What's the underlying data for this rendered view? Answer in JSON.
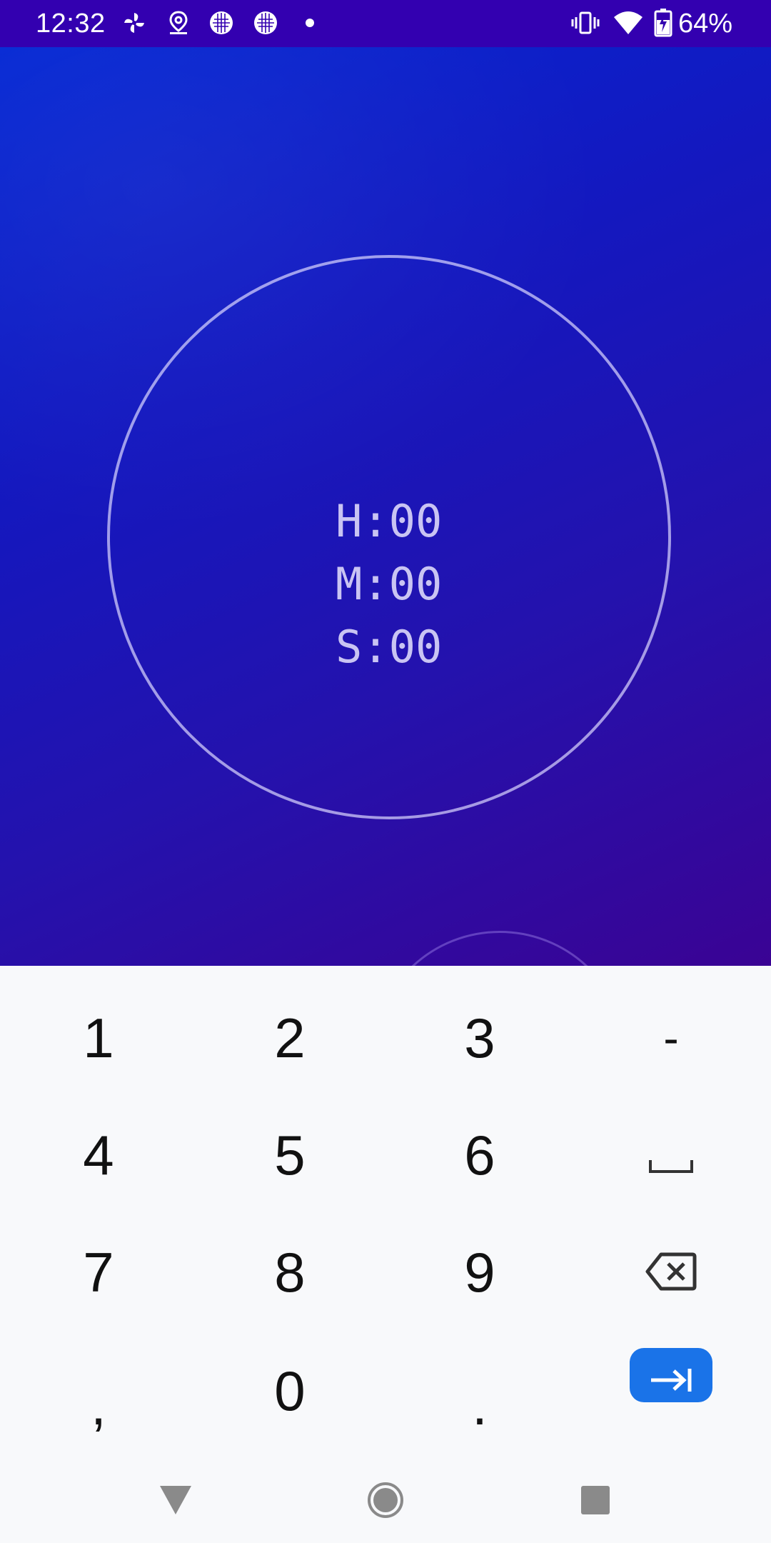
{
  "status_bar": {
    "time": "12:32",
    "battery_percent": "64%",
    "icons": [
      "pinwheel-icon",
      "location-pin-icon",
      "app-badge-icon",
      "app-badge-icon",
      "notification-dot-icon",
      "vibrate-icon",
      "wifi-icon",
      "battery-charging-icon"
    ]
  },
  "timer": {
    "hours_label": "H:00",
    "minutes_label": "M:00",
    "seconds_label": "S:00"
  },
  "keyboard": {
    "rows": [
      [
        "1",
        "2",
        "3",
        "-"
      ],
      [
        "4",
        "5",
        "6",
        "space-icon"
      ],
      [
        "7",
        "8",
        "9",
        "backspace-icon"
      ],
      [
        ",",
        "0",
        ".",
        "tab-enter-icon"
      ]
    ]
  },
  "nav_bar": {
    "buttons": [
      "back-icon",
      "home-icon",
      "recents-icon"
    ]
  },
  "colors": {
    "status_bar": "#3300b0",
    "gradient_start": "#0428d4",
    "gradient_end": "#3a0394",
    "keyboard_bg": "#f8f9fb",
    "enter_key": "#1a73e8",
    "timer_text": "#c9c4f3"
  }
}
